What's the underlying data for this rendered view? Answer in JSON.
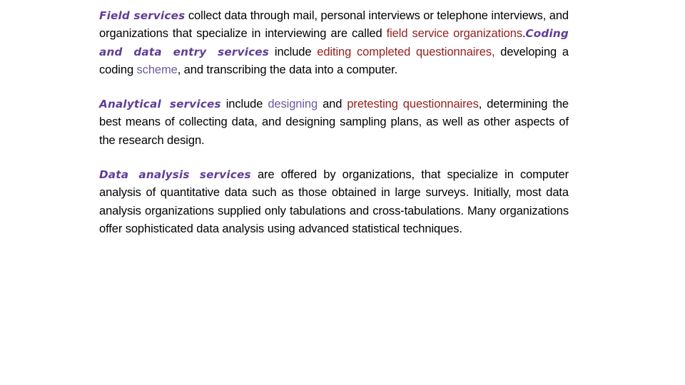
{
  "slide": {
    "background_color": "#ffffff",
    "colors": {
      "body_text": "#000000",
      "term_purple": "#5f3d96",
      "emphasis_red": "#96201f",
      "emphasis_violet": "#6f5a9e"
    },
    "paragraphs": [
      {
        "id": "field-services",
        "runs": [
          {
            "text": "Field services",
            "style": "term"
          },
          {
            "text": " collect data through mail, personal interviews or telephone interviews, and organizations that specialize in interviewing are called ",
            "style": "body"
          },
          {
            "text": "field service organizations",
            "style": "red"
          },
          {
            "text": ".",
            "style": "body"
          },
          {
            "text": "Coding and data entry services",
            "style": "term-spaced"
          },
          {
            "text": " include ",
            "style": "body"
          },
          {
            "text": "editing completed questionnaires",
            "style": "red"
          },
          {
            "text": ",",
            "style": "red"
          },
          {
            "text": " developing a coding ",
            "style": "body"
          },
          {
            "text": "scheme",
            "style": "violet"
          },
          {
            "text": ", and transcribing the data into a computer.",
            "style": "body"
          }
        ]
      },
      {
        "id": "analytical-services",
        "runs": [
          {
            "text": "Analytical services",
            "style": "term"
          },
          {
            "text": " include ",
            "style": "body"
          },
          {
            "text": "designing",
            "style": "violet"
          },
          {
            "text": " and ",
            "style": "body"
          },
          {
            "text": "pretesting questionnaires",
            "style": "red"
          },
          {
            "text": ", determining the best means of collecting data, and designing sampling plans, as well as other aspects of the research design.",
            "style": "body"
          }
        ]
      },
      {
        "id": "data-analysis-services",
        "runs": [
          {
            "text": "Data analysis services",
            "style": "term"
          },
          {
            "text": " are offered by organizations, that specialize in computer analysis of quantitative data such as those obtained in large surveys. Initially, most data analysis organizations supplied only tabulations and cross-tabulations. Many organizations offer sophisticated data analysis using advanced statistical techniques.",
            "style": "body"
          }
        ]
      }
    ],
    "text": {
      "p1_term": "Field services",
      "p1_body1": " collect data through mail, personal interviews or telephone interviews, and organizations that specialize in interviewing are called ",
      "p1_red1": "field service organizations",
      "p1_body2": ".",
      "p1_term2": "Coding and data entry services",
      "p1_body3": " include ",
      "p1_red2": "editing completed questionnaires",
      "p1_red2_comma": ",",
      "p1_body4": " developing a coding ",
      "p1_violet1": "scheme",
      "p1_body5": ", and transcribing the data into a computer.",
      "p2_term": "Analytical services",
      "p2_body1": " include ",
      "p2_violet1": "designing",
      "p2_body2": " and ",
      "p2_red1": "pretesting questionnaires",
      "p2_body3": ", determining the best means of collecting data, and designing sampling plans, as well as other aspects of the research design.",
      "p3_term": "Data analysis services",
      "p3_body1": " are offered by organizations, that specialize in computer analysis of quantitative data such as those obtained in large surveys. Initially, most data analysis organizations supplied only tabulations and cross-tabulations. Many organizations offer sophisticated data analysis using advanced statistical techniques."
    }
  }
}
